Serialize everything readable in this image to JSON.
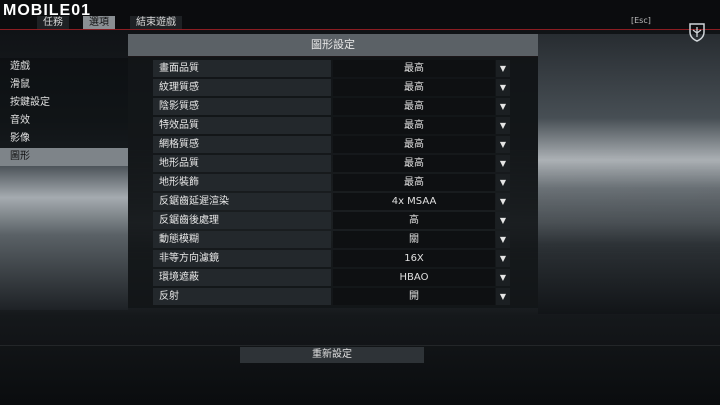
{
  "logo": {
    "text": "MOBILE01"
  },
  "tabs": [
    {
      "label": "任務"
    },
    {
      "label": "選項"
    },
    {
      "label": "結束遊戲"
    }
  ],
  "esc": {
    "label": "[Esc]"
  },
  "title": "圖形設定",
  "sidebar": {
    "items": [
      {
        "label": "遊戲"
      },
      {
        "label": "滑鼠"
      },
      {
        "label": "按鍵設定"
      },
      {
        "label": "音效"
      },
      {
        "label": "影像"
      },
      {
        "label": "圖形"
      }
    ]
  },
  "settings": [
    {
      "label": "畫面品質",
      "value": "最高"
    },
    {
      "label": "紋理質感",
      "value": "最高"
    },
    {
      "label": "陰影質感",
      "value": "最高"
    },
    {
      "label": "特效品質",
      "value": "最高"
    },
    {
      "label": "網格質感",
      "value": "最高"
    },
    {
      "label": "地形品質",
      "value": "最高"
    },
    {
      "label": "地形裝飾",
      "value": "最高"
    },
    {
      "label": "反鋸齒延遲渲染",
      "value": "4x MSAA"
    },
    {
      "label": "反鋸齒後處理",
      "value": "高"
    },
    {
      "label": "動態模糊",
      "value": "關"
    },
    {
      "label": "非等方向濾鏡",
      "value": "16X"
    },
    {
      "label": "環境遮蔽",
      "value": "HBAO"
    },
    {
      "label": "反射",
      "value": "開"
    }
  ],
  "reset": {
    "label": "重新設定"
  },
  "colors": {
    "accent_red": "#8c1d22",
    "active_tab": "#8a8f93"
  },
  "icons": {
    "dropdown": "triangle-down",
    "emblem": "shield-emblem"
  }
}
